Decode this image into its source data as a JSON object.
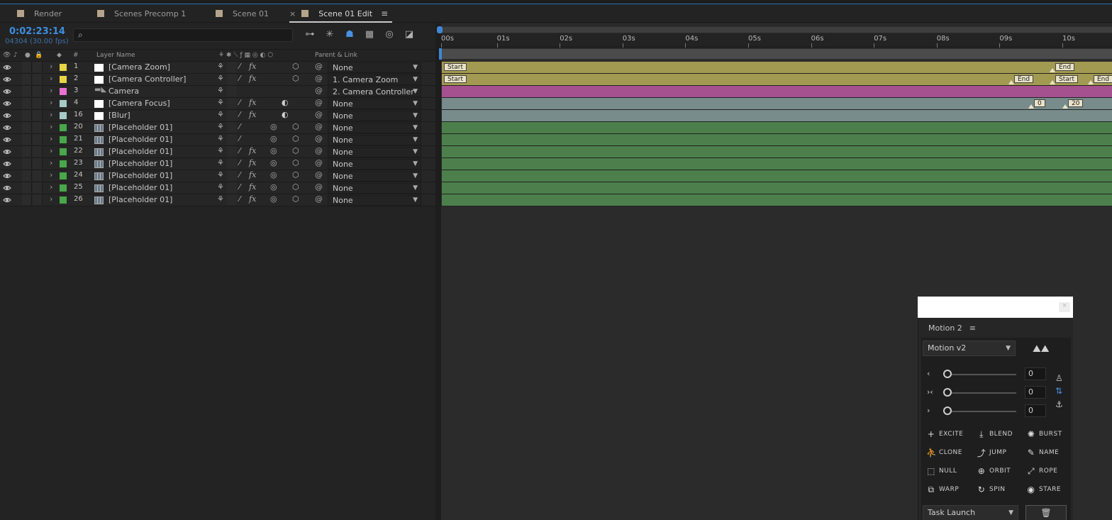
{
  "tabs": [
    {
      "label": "Render",
      "active": false
    },
    {
      "label": "Scenes Precomp 1",
      "active": false
    },
    {
      "label": "Scene 01",
      "active": false
    },
    {
      "label": "Scene 01 Edit",
      "active": true
    }
  ],
  "comp": {
    "timecode": "0:02:23:14",
    "frames": "04304 (30.00 fps)"
  },
  "columns": {
    "number": "#",
    "layer_name": "Layer Name",
    "parent": "Parent & Link"
  },
  "ruler": [
    "00s",
    "01s",
    "02s",
    "03s",
    "04s",
    "05s",
    "06s",
    "07s",
    "08s",
    "09s",
    "10s"
  ],
  "layers": [
    {
      "num": "1",
      "name": "[Camera Zoom]",
      "label_color": "#e6d545",
      "source": "white",
      "fx": true,
      "parent": "None",
      "track": "#a39a52"
    },
    {
      "num": "2",
      "name": "[Camera Controller]",
      "label_color": "#e6d545",
      "source": "white",
      "fx": true,
      "parent": "1. Camera Zoom",
      "track": "#a39a52"
    },
    {
      "num": "3",
      "name": "Camera",
      "label_color": "#e872d2",
      "source": "cam",
      "fx": false,
      "parent": "2. Camera Controller",
      "track": "#a5508f"
    },
    {
      "num": "4",
      "name": "[Camera Focus]",
      "label_color": "#a6cac8",
      "source": "white",
      "fx": true,
      "parent": "None",
      "track": "#778c8b"
    },
    {
      "num": "16",
      "name": "[Blur]",
      "label_color": "#a6cac8",
      "source": "white",
      "fx": true,
      "parent": "None",
      "track": "#778c8b"
    },
    {
      "num": "20",
      "name": "[Placeholder 01]",
      "label_color": "#4aa64a",
      "source": "ph",
      "fx": false,
      "parent": "None",
      "track": "#4c7f4c"
    },
    {
      "num": "21",
      "name": "[Placeholder 01]",
      "label_color": "#4aa64a",
      "source": "ph",
      "fx": false,
      "parent": "None",
      "track": "#4c7f4c"
    },
    {
      "num": "22",
      "name": "[Placeholder 01]",
      "label_color": "#4aa64a",
      "source": "ph",
      "fx": true,
      "parent": "None",
      "track": "#4c7f4c"
    },
    {
      "num": "23",
      "name": "[Placeholder 01]",
      "label_color": "#4aa64a",
      "source": "ph",
      "fx": true,
      "parent": "None",
      "track": "#4c7f4c"
    },
    {
      "num": "24",
      "name": "[Placeholder 01]",
      "label_color": "#4aa64a",
      "source": "ph",
      "fx": true,
      "parent": "None",
      "track": "#4c7f4c"
    },
    {
      "num": "25",
      "name": "[Placeholder 01]",
      "label_color": "#4aa64a",
      "source": "ph",
      "fx": true,
      "parent": "None",
      "track": "#4c7f4c"
    },
    {
      "num": "26",
      "name": "[Placeholder 01]",
      "label_color": "#4aa64a",
      "source": "ph",
      "fx": true,
      "parent": "None",
      "track": "#4c7f4c"
    }
  ],
  "markers": {
    "start": "Start",
    "end": "End",
    "zero": "0",
    "twenty": "20"
  },
  "motion": {
    "panel_title": "Motion 2",
    "version": "Motion v2",
    "slider_values": [
      "0",
      "0",
      "0"
    ],
    "tools": [
      "EXCITE",
      "BLEND",
      "BURST",
      "CLONE",
      "JUMP",
      "NAME",
      "NULL",
      "ORBIT",
      "ROPE",
      "WARP",
      "SPIN",
      "STARE"
    ],
    "task": "Task Launch"
  }
}
